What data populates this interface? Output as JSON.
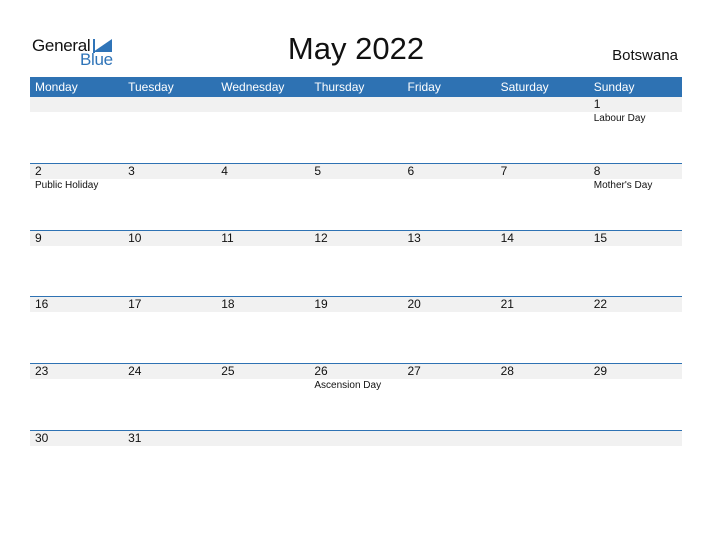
{
  "logo": {
    "line1": "General",
    "line2": "Blue"
  },
  "title": "May 2022",
  "country": "Botswana",
  "colors": {
    "accent": "#2e72b3",
    "band": "#f1f1f1"
  },
  "weekdays": [
    "Monday",
    "Tuesday",
    "Wednesday",
    "Thursday",
    "Friday",
    "Saturday",
    "Sunday"
  ],
  "weeks": [
    {
      "days": [
        {
          "num": "",
          "event": ""
        },
        {
          "num": "",
          "event": ""
        },
        {
          "num": "",
          "event": ""
        },
        {
          "num": "",
          "event": ""
        },
        {
          "num": "",
          "event": ""
        },
        {
          "num": "",
          "event": ""
        },
        {
          "num": "1",
          "event": "Labour Day"
        }
      ]
    },
    {
      "days": [
        {
          "num": "2",
          "event": "Public Holiday"
        },
        {
          "num": "3",
          "event": ""
        },
        {
          "num": "4",
          "event": ""
        },
        {
          "num": "5",
          "event": ""
        },
        {
          "num": "6",
          "event": ""
        },
        {
          "num": "7",
          "event": ""
        },
        {
          "num": "8",
          "event": "Mother's Day"
        }
      ]
    },
    {
      "days": [
        {
          "num": "9",
          "event": ""
        },
        {
          "num": "10",
          "event": ""
        },
        {
          "num": "11",
          "event": ""
        },
        {
          "num": "12",
          "event": ""
        },
        {
          "num": "13",
          "event": ""
        },
        {
          "num": "14",
          "event": ""
        },
        {
          "num": "15",
          "event": ""
        }
      ]
    },
    {
      "days": [
        {
          "num": "16",
          "event": ""
        },
        {
          "num": "17",
          "event": ""
        },
        {
          "num": "18",
          "event": ""
        },
        {
          "num": "19",
          "event": ""
        },
        {
          "num": "20",
          "event": ""
        },
        {
          "num": "21",
          "event": ""
        },
        {
          "num": "22",
          "event": ""
        }
      ]
    },
    {
      "days": [
        {
          "num": "23",
          "event": ""
        },
        {
          "num": "24",
          "event": ""
        },
        {
          "num": "25",
          "event": ""
        },
        {
          "num": "26",
          "event": "Ascension Day"
        },
        {
          "num": "27",
          "event": ""
        },
        {
          "num": "28",
          "event": ""
        },
        {
          "num": "29",
          "event": ""
        }
      ]
    },
    {
      "days": [
        {
          "num": "30",
          "event": ""
        },
        {
          "num": "31",
          "event": ""
        },
        {
          "num": "",
          "event": ""
        },
        {
          "num": "",
          "event": ""
        },
        {
          "num": "",
          "event": ""
        },
        {
          "num": "",
          "event": ""
        },
        {
          "num": "",
          "event": ""
        }
      ]
    }
  ]
}
